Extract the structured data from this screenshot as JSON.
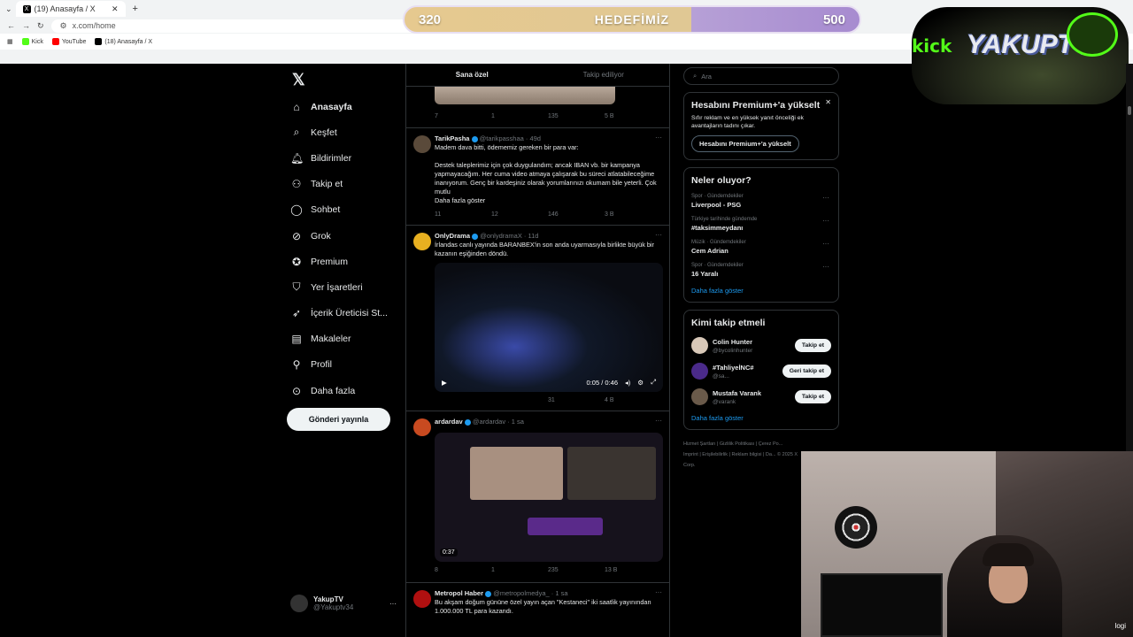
{
  "browser": {
    "tab_title": "(19) Anasayfa / X",
    "url": "x.com/home",
    "bookmarks": [
      "Kick",
      "YouTube",
      "(18) Anasayfa / X"
    ]
  },
  "overlay": {
    "goal_current": "320",
    "goal_label": "HEDEFİMİZ",
    "goal_target": "500",
    "goal_progress": 0.64,
    "kick_logo": "kick",
    "channel_logo": "YAKUPTV"
  },
  "nav": {
    "items": [
      "Anasayfa",
      "Keşfet",
      "Bildirimler",
      "Takip et",
      "Sohbet",
      "Grok",
      "Premium",
      "Yer İşaretleri",
      "İçerik Üreticisi St...",
      "Makaleler",
      "Profil",
      "Daha fazla"
    ],
    "post_button": "Gönderi yayınla",
    "account_name": "YakupTV",
    "account_handle": "@Yakuptv34"
  },
  "feed": {
    "tabs": [
      "Sana özel",
      "Takip ediliyor"
    ],
    "top_post_actions": [
      "7",
      "1",
      "135",
      "5 B"
    ],
    "posts": [
      {
        "name": "TarikPasha",
        "handle": "@tarikpasshaa · 49d",
        "text1": "Madem dava bitti, ödememiz gereken bir para var:",
        "text2": "Destek taleplerimiz için çok duygulandım; ancak IBAN vb. bir kampanya yapmayacağım. Her cuma video atmaya çalışarak bu süreci atlatabileceğime inanıyorum. Genç bir kardeşiniz olarak yorumlarınızı okumam bile yeterli. Çok mutlu",
        "more": "Daha fazla göster",
        "actions": [
          "11",
          "12",
          "146",
          "3 B"
        ]
      },
      {
        "name": "OnlyDrama",
        "handle": "@onlydramaX · 11d",
        "text1": "İrlandas canlı yayında BARANBEX'in son anda uyarmasıyla birlikte büyük bir kazanın eşiğinden döndü.",
        "video_time": "0:05 / 0:46",
        "actions": [
          "",
          "",
          "31",
          "4 B"
        ]
      },
      {
        "name": "ardardav",
        "handle": "@ardardav · 1 sa",
        "video_time": "0:37",
        "actions": [
          "8",
          "1",
          "235",
          "13 B"
        ]
      },
      {
        "name": "Metropol Haber",
        "handle": "@metropolmedya_ · 1 sa",
        "text1": "Bu akşam doğum gününe özel yayın açan \"Kestaneci\" iki saatlik yayınından 1.000.000 TL para kazandı."
      }
    ]
  },
  "sidebar": {
    "search_placeholder": "Ara",
    "premium_title": "Hesabını Premium+'a yükselt",
    "premium_text": "Sıfır reklam ve en yüksek yanıt önceliği ek avantajların tadını çıkar.",
    "premium_button": "Hesabını Premium+'a yükselt",
    "trends_title": "Neler oluyor?",
    "trends": [
      {
        "category": "Spor · Gündemdekiler",
        "name": "Liverpool - PSG"
      },
      {
        "category": "Türkiye tarihinde gündemde",
        "name": "#taksimmeydanı"
      },
      {
        "category": "Müzik · Gündemdekiler",
        "name": "Cem Adrian"
      },
      {
        "category": "Spor · Gündemdekiler",
        "name": "16 Yaralı"
      }
    ],
    "show_more": "Daha fazla göster",
    "who_title": "Kimi takip etmeli",
    "who": [
      {
        "name": "Colin Hunter",
        "handle": "@bycolinhunter",
        "button": "Takip et"
      },
      {
        "name": "#TahliyeİNC#",
        "handle": "@sa...",
        "button": "Geri takip et"
      },
      {
        "name": "Mustafa Varank",
        "handle": "@varank",
        "button": "Takip et"
      }
    ],
    "footer": "Hizmet Şartları | Gizlilik Politikası | Çerez Po... Imprint | Erişilebilirlik | Reklam bilgisi | Da... © 2025 X Corp."
  },
  "webcam": {
    "brand": "logi"
  }
}
